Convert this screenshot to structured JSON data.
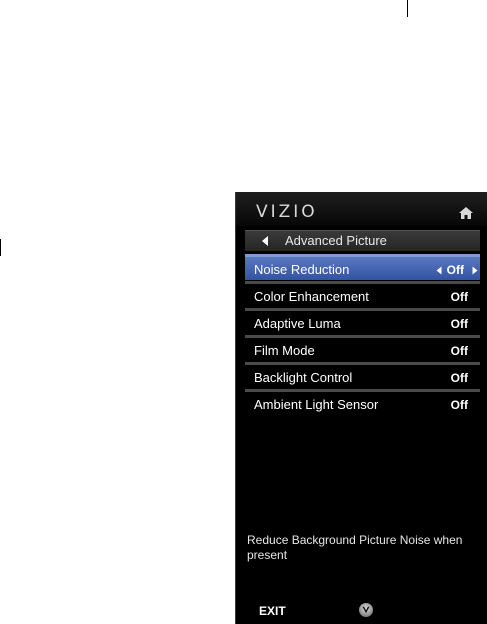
{
  "brand": {
    "logo": "VIZIO"
  },
  "header": {
    "home_icon": "home-icon"
  },
  "titlebar": {
    "back_icon": "left-arrow-icon",
    "title": "Advanced Picture"
  },
  "menu": {
    "items": [
      {
        "label": "Noise Reduction",
        "value": "Off",
        "selected": true
      },
      {
        "label": "Color Enhancement",
        "value": "Off"
      },
      {
        "label": "Adaptive Luma",
        "value": "Off"
      },
      {
        "label": "Film Mode",
        "value": "Off"
      },
      {
        "label": "Backlight Control",
        "value": "Off"
      },
      {
        "label": "Ambient Light Sensor",
        "value": "Off"
      }
    ]
  },
  "help_text": "Reduce Background Picture Noise when present",
  "footer": {
    "exit_label": "EXIT",
    "v_button_icon": "vizio-v-button-icon"
  },
  "colors": {
    "selected_bar": "#3f63b7",
    "background": "#000000",
    "separator": "#4a4a4a"
  }
}
